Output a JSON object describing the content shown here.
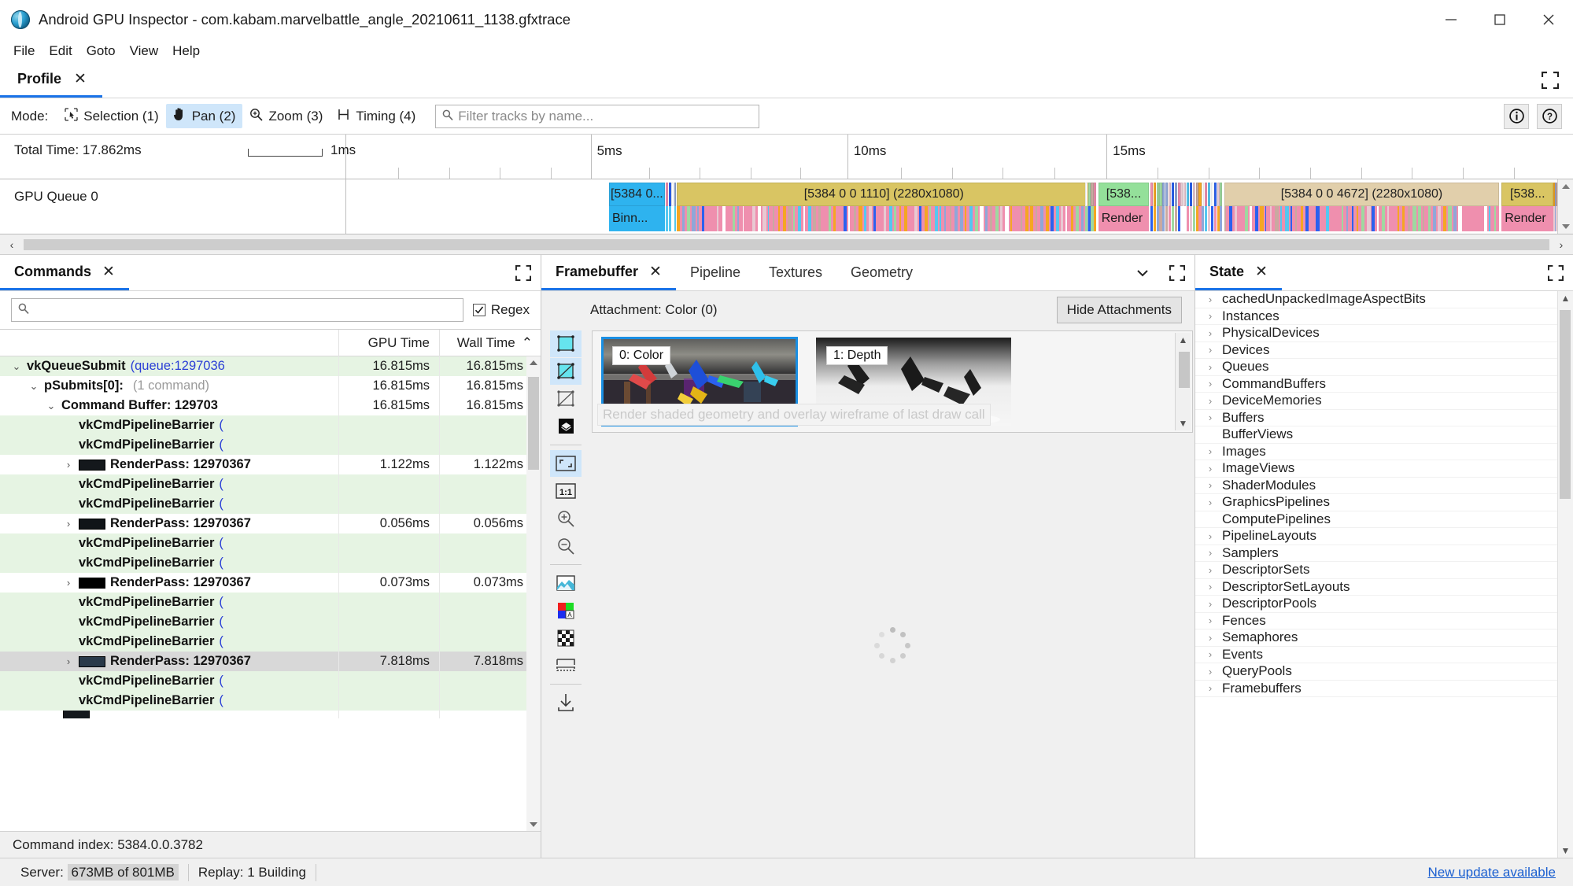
{
  "window": {
    "title": "Android GPU Inspector - com.kabam.marvelbattle_angle_20210611_1138.gfxtrace",
    "app_icon": "agi-globe-icon",
    "minimize": "minimize-icon",
    "maximize": "maximize-icon",
    "close": "close-icon"
  },
  "menu": {
    "items": [
      "File",
      "Edit",
      "Goto",
      "View",
      "Help"
    ]
  },
  "profile_tab": {
    "label": "Profile",
    "close": "✕",
    "expand_icon": "expand-icon"
  },
  "mode_bar": {
    "label": "Mode:",
    "buttons": [
      {
        "label": "Selection (1)",
        "icon": "selection-icon",
        "active": false
      },
      {
        "label": "Pan (2)",
        "icon": "hand-icon",
        "active": true
      },
      {
        "label": "Zoom (3)",
        "icon": "magnifier-icon",
        "active": false
      },
      {
        "label": "Timing (4)",
        "icon": "timing-icon",
        "active": false
      }
    ],
    "filter_placeholder": "Filter tracks by name...",
    "filter_value": "",
    "info_icon": "info-icon",
    "help_icon": "help-icon"
  },
  "timeline": {
    "total_time": "Total Time: 17.862ms",
    "scale_label": "1ms",
    "major_ticks": [
      {
        "label": "5ms",
        "x_pct": 20.2
      },
      {
        "label": "10ms",
        "x_pct": 41.4
      },
      {
        "label": "15ms",
        "x_pct": 62.8
      }
    ],
    "track_name": "GPU Queue 0",
    "segments": [
      {
        "label": "[5384 0...",
        "sub": "Binn...",
        "left_pct": 21.7,
        "width_pct": 4.6,
        "color": "#2eb3ef",
        "sub_color": "#2eb3ef"
      },
      {
        "label": "[5384 0 0 1110] (2280x1080)",
        "sub": "",
        "left_pct": 27.3,
        "width_pct": 34.2,
        "color": "#d9c563",
        "sub_color": "#ef8fae"
      },
      {
        "label": "[538...",
        "sub": "Render",
        "left_pct": 62.1,
        "width_pct": 4.2,
        "color": "#94e09a",
        "sub_color": "#ef8fae"
      },
      {
        "label": "[5384 0 0 4672] (2280x1080)",
        "sub": "",
        "left_pct": 72.5,
        "width_pct": 22.7,
        "color": "#e1cfab",
        "sub_color": "#ef8fae"
      },
      {
        "label": "[538...",
        "sub": "Render",
        "left_pct": 95.4,
        "width_pct": 4.3,
        "color": "#d9c563",
        "sub_color": "#ef8fae"
      }
    ],
    "hscroll_left_arrow": "‹",
    "hscroll_right_arrow": "›"
  },
  "commands_panel": {
    "tab_label": "Commands",
    "tab_close": "✕",
    "expand_icon": "expand-icon",
    "search_placeholder": "",
    "search_value": "",
    "search_icon": "search-icon",
    "regex_label": "Regex",
    "regex_checked": true,
    "columns": {
      "name": "",
      "gpu": "GPU Time",
      "wall": "Wall Time",
      "sort": "⌃"
    },
    "rows": [
      {
        "indent": 0,
        "caret": "⌄",
        "name": "vkQueueSubmit",
        "suffix": "(queue:1297036",
        "suffix_class": "blue",
        "gpu": "16.815ms",
        "wall": "16.815ms",
        "style": "alt",
        "thumb": false
      },
      {
        "indent": 1,
        "caret": "⌄",
        "name": "pSubmits[0]:",
        "suffix": "(1 command)",
        "suffix_class": "grey",
        "gpu": "16.815ms",
        "wall": "16.815ms",
        "style": "",
        "thumb": false
      },
      {
        "indent": 2,
        "caret": "⌄",
        "name": "Command Buffer: 129703",
        "suffix": "",
        "suffix_class": "",
        "gpu": "16.815ms",
        "wall": "16.815ms",
        "style": "",
        "thumb": false
      },
      {
        "indent": 3,
        "caret": "",
        "name": "vkCmdPipelineBarrier",
        "suffix": "(",
        "suffix_class": "blue",
        "gpu": "",
        "wall": "",
        "style": "alt",
        "thumb": false
      },
      {
        "indent": 3,
        "caret": "",
        "name": "vkCmdPipelineBarrier",
        "suffix": "(",
        "suffix_class": "blue",
        "gpu": "",
        "wall": "",
        "style": "alt",
        "thumb": false
      },
      {
        "indent": 3,
        "caret": "›",
        "name": "RenderPass: 12970367",
        "suffix": "",
        "suffix_class": "",
        "gpu": "1.122ms",
        "wall": "1.122ms",
        "style": "",
        "thumb": true,
        "thumb_color": "#14181c"
      },
      {
        "indent": 3,
        "caret": "",
        "name": "vkCmdPipelineBarrier",
        "suffix": "(",
        "suffix_class": "blue",
        "gpu": "",
        "wall": "",
        "style": "alt",
        "thumb": false
      },
      {
        "indent": 3,
        "caret": "",
        "name": "vkCmdPipelineBarrier",
        "suffix": "(",
        "suffix_class": "blue",
        "gpu": "",
        "wall": "",
        "style": "alt",
        "thumb": false
      },
      {
        "indent": 3,
        "caret": "›",
        "name": "RenderPass: 12970367",
        "suffix": "",
        "suffix_class": "",
        "gpu": "0.056ms",
        "wall": "0.056ms",
        "style": "",
        "thumb": true,
        "thumb_color": "#101418"
      },
      {
        "indent": 3,
        "caret": "",
        "name": "vkCmdPipelineBarrier",
        "suffix": "(",
        "suffix_class": "blue",
        "gpu": "",
        "wall": "",
        "style": "alt",
        "thumb": false
      },
      {
        "indent": 3,
        "caret": "",
        "name": "vkCmdPipelineBarrier",
        "suffix": "(",
        "suffix_class": "blue",
        "gpu": "",
        "wall": "",
        "style": "alt",
        "thumb": false
      },
      {
        "indent": 3,
        "caret": "›",
        "name": "RenderPass: 12970367",
        "suffix": "",
        "suffix_class": "",
        "gpu": "0.073ms",
        "wall": "0.073ms",
        "style": "",
        "thumb": true,
        "thumb_color": "#000000"
      },
      {
        "indent": 3,
        "caret": "",
        "name": "vkCmdPipelineBarrier",
        "suffix": "(",
        "suffix_class": "blue",
        "gpu": "",
        "wall": "",
        "style": "alt",
        "thumb": false
      },
      {
        "indent": 3,
        "caret": "",
        "name": "vkCmdPipelineBarrier",
        "suffix": "(",
        "suffix_class": "blue",
        "gpu": "",
        "wall": "",
        "style": "alt",
        "thumb": false
      },
      {
        "indent": 3,
        "caret": "",
        "name": "vkCmdPipelineBarrier",
        "suffix": "(",
        "suffix_class": "blue",
        "gpu": "",
        "wall": "",
        "style": "alt",
        "thumb": false
      },
      {
        "indent": 3,
        "caret": "›",
        "name": "RenderPass: 12970367",
        "suffix": "",
        "suffix_class": "",
        "gpu": "7.818ms",
        "wall": "7.818ms",
        "style": "sel",
        "thumb": true,
        "thumb_color": "#2a3a4a"
      },
      {
        "indent": 3,
        "caret": "",
        "name": "vkCmdPipelineBarrier",
        "suffix": "(",
        "suffix_class": "blue",
        "gpu": "",
        "wall": "",
        "style": "alt",
        "thumb": false
      },
      {
        "indent": 3,
        "caret": "",
        "name": "vkCmdPipelineBarrier",
        "suffix": "(",
        "suffix_class": "blue",
        "gpu": "",
        "wall": "",
        "style": "alt",
        "thumb": false
      }
    ],
    "status": "Command index: 5384.0.0.3782"
  },
  "framebuffer_panel": {
    "tabs": [
      {
        "label": "Framebuffer",
        "active": true,
        "close": "✕"
      },
      {
        "label": "Pipeline",
        "active": false
      },
      {
        "label": "Textures",
        "active": false
      },
      {
        "label": "Geometry",
        "active": false
      }
    ],
    "chevron_icon": "chevron-down-icon",
    "expand_icon": "expand-icon",
    "attachment_label": "Attachment: Color (0)",
    "hide_attachments_label": "Hide Attachments",
    "tooltip_text": "Render shaded geometry and overlay wireframe of last draw call",
    "thumbnails": [
      {
        "badge": "0: Color",
        "selected": true
      },
      {
        "badge": "1: Depth",
        "selected": false
      }
    ],
    "tools": [
      {
        "icon": "render-shaded-icon",
        "active": true
      },
      {
        "icon": "render-shaded-wireframe-icon",
        "active": true
      },
      {
        "icon": "render-wireframe-icon",
        "active": false
      },
      {
        "icon": "render-overdraw-icon",
        "active": false
      },
      {
        "sep": true
      },
      {
        "icon": "fit-to-window-icon",
        "active": true
      },
      {
        "icon": "actual-size-icon",
        "active": false
      },
      {
        "icon": "zoom-in-icon",
        "active": false
      },
      {
        "icon": "zoom-out-icon",
        "active": false
      },
      {
        "sep": true
      },
      {
        "icon": "color-histogram-icon",
        "active": false
      },
      {
        "icon": "color-channels-icon",
        "active": false
      },
      {
        "icon": "checkerboard-background-icon",
        "active": false
      },
      {
        "icon": "flip-vertically-icon",
        "active": false
      },
      {
        "sep": true
      },
      {
        "icon": "save-image-icon",
        "active": false
      }
    ]
  },
  "state_panel": {
    "tab_label": "State",
    "tab_close": "✕",
    "expand_icon": "expand-icon",
    "items": [
      {
        "label": "cachedUnpackedImageAspectBits",
        "expandable": true
      },
      {
        "label": "Instances",
        "expandable": true
      },
      {
        "label": "PhysicalDevices",
        "expandable": true
      },
      {
        "label": "Devices",
        "expandable": true
      },
      {
        "label": "Queues",
        "expandable": true
      },
      {
        "label": "CommandBuffers",
        "expandable": true
      },
      {
        "label": "DeviceMemories",
        "expandable": true
      },
      {
        "label": "Buffers",
        "expandable": true
      },
      {
        "label": "BufferViews",
        "expandable": false
      },
      {
        "label": "Images",
        "expandable": true
      },
      {
        "label": "ImageViews",
        "expandable": true
      },
      {
        "label": "ShaderModules",
        "expandable": true
      },
      {
        "label": "GraphicsPipelines",
        "expandable": true
      },
      {
        "label": "ComputePipelines",
        "expandable": false
      },
      {
        "label": "PipelineLayouts",
        "expandable": true
      },
      {
        "label": "Samplers",
        "expandable": true
      },
      {
        "label": "DescriptorSets",
        "expandable": true
      },
      {
        "label": "DescriptorSetLayouts",
        "expandable": true
      },
      {
        "label": "DescriptorPools",
        "expandable": true
      },
      {
        "label": "Fences",
        "expandable": true
      },
      {
        "label": "Semaphores",
        "expandable": true
      },
      {
        "label": "Events",
        "expandable": true
      },
      {
        "label": "QueryPools",
        "expandable": true
      },
      {
        "label": "Framebuffers",
        "expandable": true
      }
    ]
  },
  "statusbar": {
    "server_label": "Server:",
    "server_value": "673MB of 801MB",
    "replay": "Replay: 1 Building",
    "update_link": "New update available"
  }
}
